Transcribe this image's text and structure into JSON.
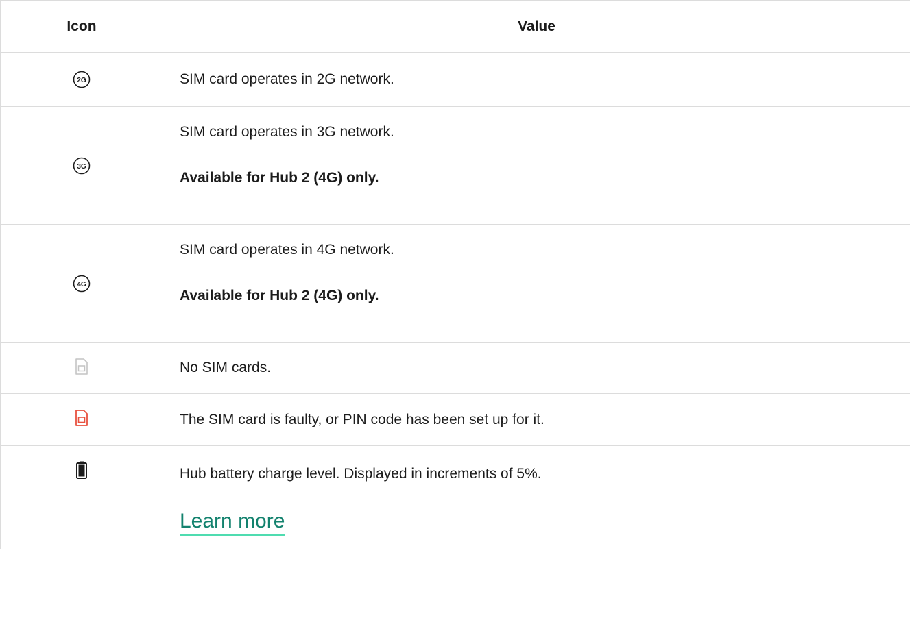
{
  "table": {
    "headers": {
      "icon": "Icon",
      "value": "Value"
    },
    "rows": [
      {
        "icon": "network-2g-icon",
        "icon_label": "2G",
        "text": "SIM card operates in 2G network."
      },
      {
        "icon": "network-3g-icon",
        "icon_label": "3G",
        "text": "SIM card operates in 3G network.",
        "note": "Available for Hub 2 (4G) only."
      },
      {
        "icon": "network-4g-icon",
        "icon_label": "4G",
        "text": "SIM card operates in 4G network.",
        "note": "Available for Hub 2 (4G) only."
      },
      {
        "icon": "sim-card-absent-icon",
        "icon_color": "#c4c4c4",
        "text": "No SIM cards."
      },
      {
        "icon": "sim-card-error-icon",
        "icon_color": "#e8513f",
        "text": "The SIM card is faulty, or PIN code has been set up for it."
      },
      {
        "icon": "battery-icon",
        "icon_color": "#1c1c1c",
        "text": "Hub battery charge level. Displayed in increments of 5%.",
        "link": "Learn more"
      }
    ]
  },
  "colors": {
    "border": "#dcdcdc",
    "text": "#1c1c1c",
    "link": "#13826e",
    "link_underline": "#4fdcb0"
  }
}
